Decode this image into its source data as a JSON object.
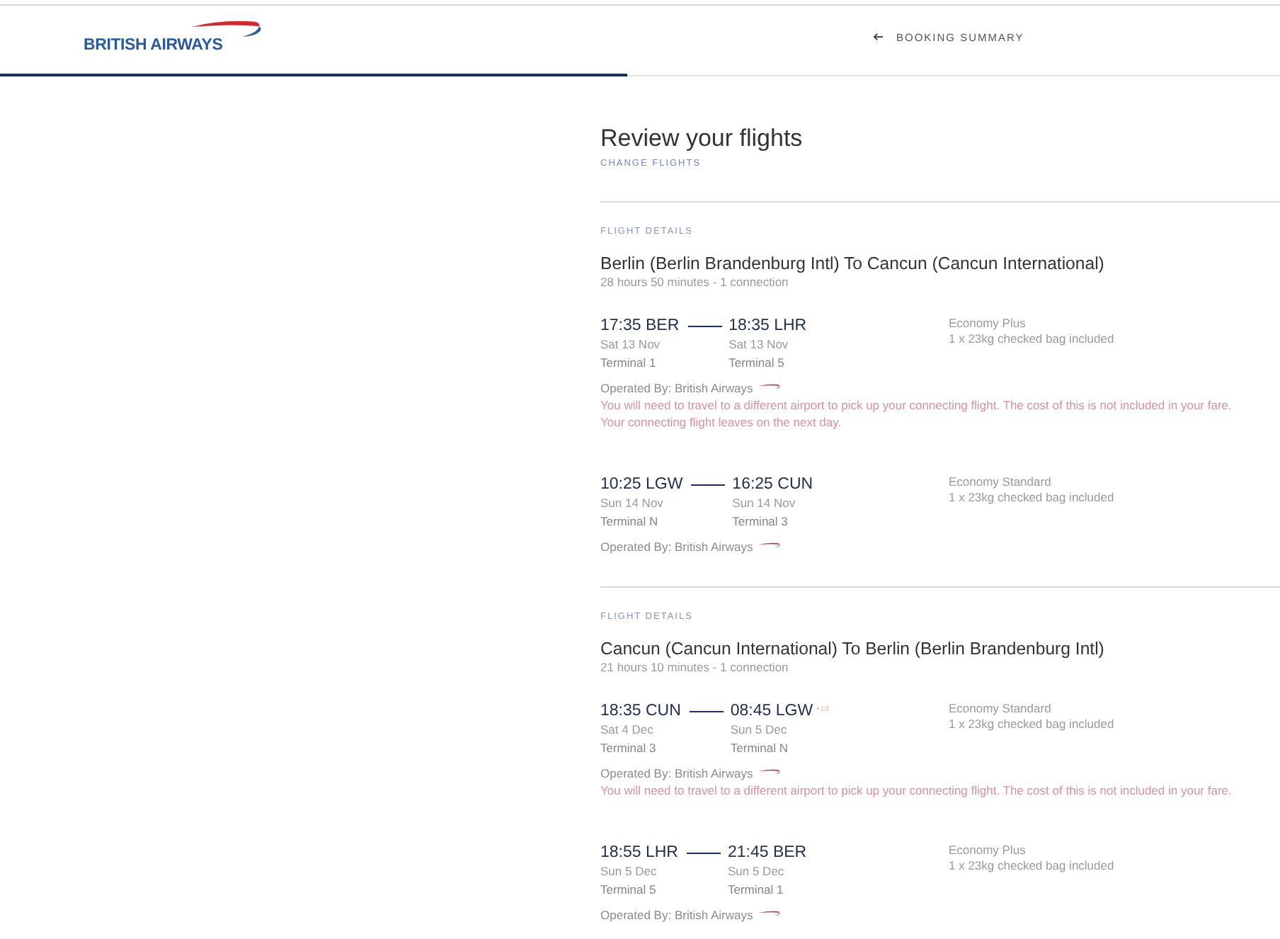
{
  "header": {
    "logo_text": "BRITISH AIRWAYS",
    "nav_link": "BOOKING SUMMARY"
  },
  "progress": {
    "level": 0.49
  },
  "page": {
    "title": "Review your flights",
    "change_link": "CHANGE FLIGHTS"
  },
  "journeys": [
    {
      "section_label": "FLIGHT DETAILS",
      "route": "Berlin (Berlin Brandenburg Intl) To Cancun (Cancun International)",
      "summary": "28 hours 50 minutes - 1 connection",
      "segments": [
        {
          "departure": {
            "time": "17:35 BER",
            "date": "Sat 13 Nov",
            "terminal": "Terminal 1"
          },
          "arrival": {
            "time": "18:35 LHR",
            "date": "Sat 13 Nov",
            "terminal": "Terminal 5"
          },
          "cabin": "Economy Plus",
          "baggage": "1 x 23kg checked bag included",
          "operator": "Operated By: British Airways",
          "notices": [
            "You will need to travel to a different airport to pick up your connecting flight. The cost of this is not included in your fare.",
            "Your connecting flight leaves on the next day."
          ]
        },
        {
          "departure": {
            "time": "10:25 LGW",
            "date": "Sun 14 Nov",
            "terminal": "Terminal N"
          },
          "arrival": {
            "time": "16:25 CUN",
            "date": "Sun 14 Nov",
            "terminal": "Terminal 3"
          },
          "cabin": "Economy Standard",
          "baggage": "1 x 23kg checked bag included",
          "operator": "Operated By: British Airways"
        }
      ]
    },
    {
      "section_label": "FLIGHT DETAILS",
      "route": "Cancun (Cancun International) To Berlin (Berlin Brandenburg Intl)",
      "summary": "21 hours 10 minutes - 1 connection",
      "segments": [
        {
          "departure": {
            "time": "18:35 CUN",
            "date": "Sat 4 Dec",
            "terminal": "Terminal 3"
          },
          "arrival": {
            "time": "08:45 LGW",
            "day_offset": "+1d",
            "date": "Sun 5 Dec",
            "terminal": "Terminal N"
          },
          "cabin": "Economy Standard",
          "baggage": "1 x 23kg checked bag included",
          "operator": "Operated By: British Airways",
          "notices": [
            "You will need to travel to a different airport to pick up your connecting flight. The cost of this is not included in your fare."
          ]
        },
        {
          "departure": {
            "time": "18:55 LHR",
            "date": "Sun 5 Dec",
            "terminal": "Terminal 5"
          },
          "arrival": {
            "time": "21:45 BER",
            "date": "Sun 5 Dec",
            "terminal": "Terminal 1"
          },
          "cabin": "Economy Plus",
          "baggage": "1 x 23kg checked bag included",
          "operator": "Operated By: British Airways"
        }
      ]
    }
  ]
}
